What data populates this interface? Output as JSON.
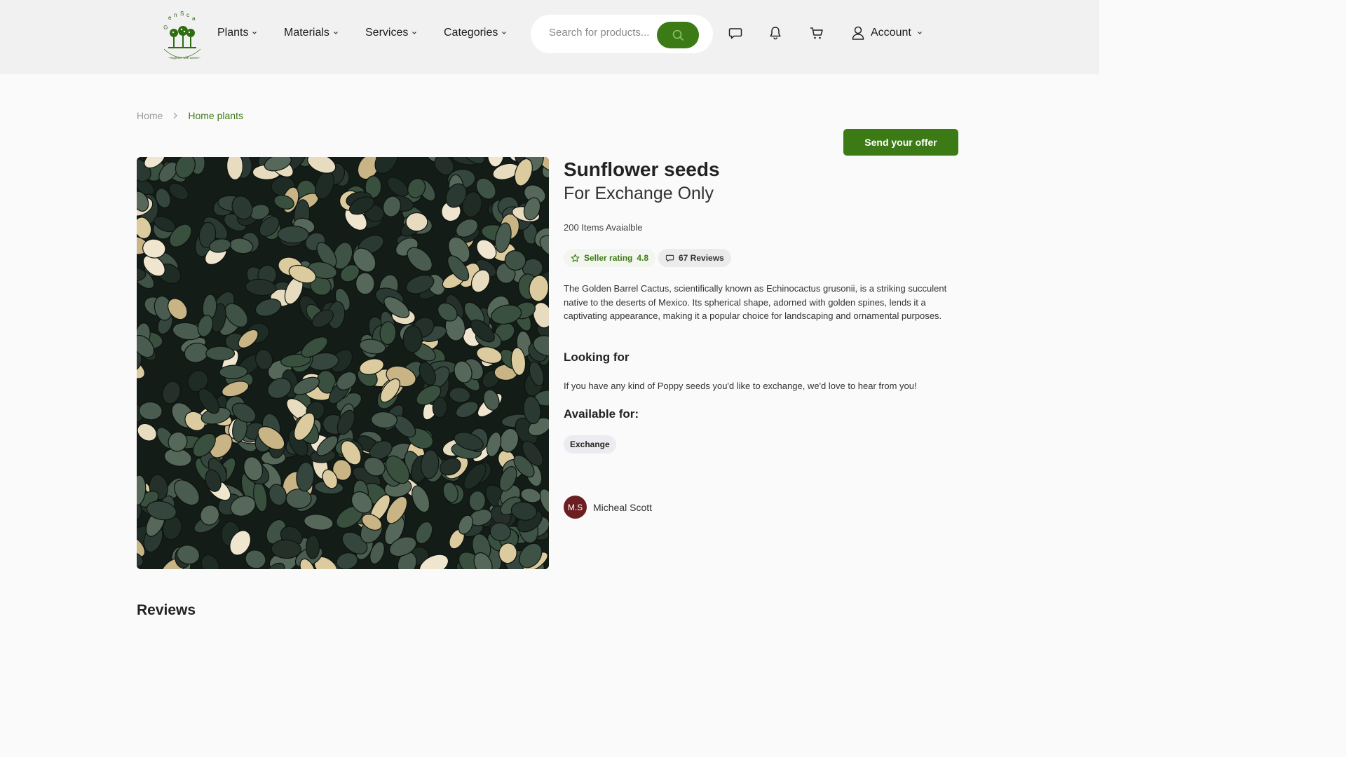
{
  "header": {
    "logo_text": "Gensca · Together with Green",
    "nav": [
      {
        "label": "Plants"
      },
      {
        "label": "Materials"
      },
      {
        "label": "Services"
      },
      {
        "label": "Categories"
      }
    ],
    "search": {
      "placeholder": "Search for products..."
    },
    "account_label": "Account"
  },
  "breadcrumb": {
    "home": "Home",
    "current": "Home plants"
  },
  "actions": {
    "offer_label": "Send your offer"
  },
  "product": {
    "title": "Sunflower seeds",
    "subtitle": "For Exchange Only",
    "stock": "200 Items Avaialble",
    "rating_label": "Seller rating",
    "rating_value": "4.8",
    "reviews_label": "67 Reviews",
    "description": "The Golden Barrel Cactus, scientifically known as Echinocactus grusonii, is a striking succulent native to the deserts of Mexico. Its spherical shape, adorned with golden spines, lends it a captivating appearance, making it a popular choice for landscaping and ornamental purposes.",
    "looking_heading": "Looking for",
    "looking_text": "If you have any kind of Poppy seeds you'd like to exchange, we'd love to hear from you!",
    "available_heading": "Available for:",
    "available_tags": [
      "Exchange"
    ]
  },
  "seller": {
    "initials": "M.S",
    "name": "Micheal Scott"
  },
  "reviews_heading": "Reviews",
  "colors": {
    "accent": "#3c7a16",
    "avatar": "#6b1f22",
    "header_bg": "#f1f1f1"
  }
}
